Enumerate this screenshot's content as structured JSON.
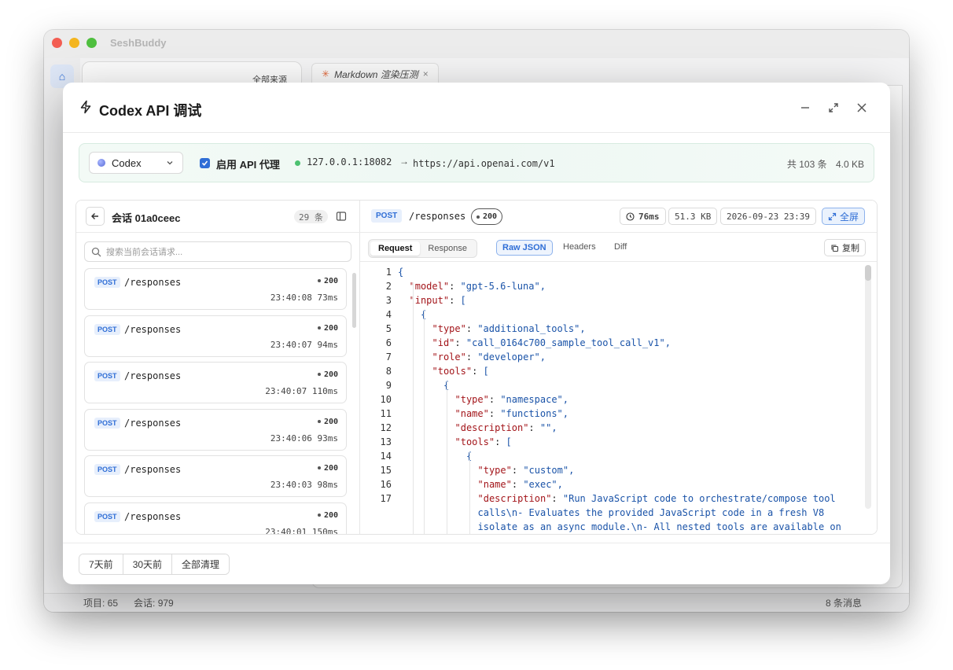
{
  "app": {
    "title": "SeshBuddy"
  },
  "background": {
    "sources_label": "全部来源",
    "doc_tab": "Markdown 渲染压测",
    "status": {
      "items": "项目: 65",
      "sessions": "会话: 979",
      "messages": "8 条消息"
    }
  },
  "modal": {
    "title": "Codex API 调试",
    "provider": "Codex",
    "proxy_label": "启用 API 代理",
    "proxy_enabled": true,
    "listen_addr": "127.0.0.1:18082",
    "arrow": "→",
    "target_url": "https://api.openai.com/v1",
    "total_count": "共 103 条",
    "total_size": "4.0 KB",
    "session": {
      "title": "会话 01a0ceec",
      "count": "29 条",
      "search_placeholder": "搜索当前会话请求..."
    },
    "requests": [
      {
        "method": "POST",
        "path": "/responses",
        "status": "200",
        "time": "23:40:08",
        "duration": "73ms"
      },
      {
        "method": "POST",
        "path": "/responses",
        "status": "200",
        "time": "23:40:07",
        "duration": "94ms"
      },
      {
        "method": "POST",
        "path": "/responses",
        "status": "200",
        "time": "23:40:07",
        "duration": "110ms"
      },
      {
        "method": "POST",
        "path": "/responses",
        "status": "200",
        "time": "23:40:06",
        "duration": "93ms"
      },
      {
        "method": "POST",
        "path": "/responses",
        "status": "200",
        "time": "23:40:03",
        "duration": "98ms"
      },
      {
        "method": "POST",
        "path": "/responses",
        "status": "200",
        "time": "23:40:01",
        "duration": "150ms"
      }
    ],
    "detail": {
      "method": "POST",
      "path": "/responses",
      "status": "200",
      "duration": "76ms",
      "size": "51.3 KB",
      "timestamp": "2026-09-23 23:39",
      "fullscreen_label": "全屏",
      "tabs": {
        "request": "Request",
        "response": "Response"
      },
      "views": {
        "raw": "Raw JSON",
        "headers": "Headers",
        "diff": "Diff"
      },
      "copy_label": "复制"
    },
    "code_lines": [
      {
        "n": "1",
        "depth": 0,
        "k": "",
        "sep": "",
        "v": "",
        "tail": "{"
      },
      {
        "n": "2",
        "depth": 1,
        "k": "\"model\"",
        "sep": ": ",
        "v": "\"gpt-5.6-luna\"",
        "tail": ","
      },
      {
        "n": "3",
        "depth": 1,
        "k": "\"input\"",
        "sep": ": ",
        "v": "",
        "tail": "["
      },
      {
        "n": "4",
        "depth": 2,
        "k": "",
        "sep": "",
        "v": "",
        "tail": "{"
      },
      {
        "n": "5",
        "depth": 3,
        "k": "\"type\"",
        "sep": ": ",
        "v": "\"additional_tools\"",
        "tail": ","
      },
      {
        "n": "6",
        "depth": 3,
        "k": "\"id\"",
        "sep": ": ",
        "v": "\"call_0164c700_sample_tool_call_v1\"",
        "tail": ","
      },
      {
        "n": "7",
        "depth": 3,
        "k": "\"role\"",
        "sep": ": ",
        "v": "\"developer\"",
        "tail": ","
      },
      {
        "n": "8",
        "depth": 3,
        "k": "\"tools\"",
        "sep": ": ",
        "v": "",
        "tail": "["
      },
      {
        "n": "9",
        "depth": 4,
        "k": "",
        "sep": "",
        "v": "",
        "tail": "{"
      },
      {
        "n": "10",
        "depth": 5,
        "k": "\"type\"",
        "sep": ": ",
        "v": "\"namespace\"",
        "tail": ","
      },
      {
        "n": "11",
        "depth": 5,
        "k": "\"name\"",
        "sep": ": ",
        "v": "\"functions\"",
        "tail": ","
      },
      {
        "n": "12",
        "depth": 5,
        "k": "\"description\"",
        "sep": ": ",
        "v": "\"\"",
        "tail": ","
      },
      {
        "n": "13",
        "depth": 5,
        "k": "\"tools\"",
        "sep": ": ",
        "v": "",
        "tail": "["
      },
      {
        "n": "14",
        "depth": 6,
        "k": "",
        "sep": "",
        "v": "",
        "tail": "{"
      },
      {
        "n": "15",
        "depth": 7,
        "k": "\"type\"",
        "sep": ": ",
        "v": "\"custom\"",
        "tail": ","
      },
      {
        "n": "16",
        "depth": 7,
        "k": "\"name\"",
        "sep": ": ",
        "v": "\"exec\"",
        "tail": ","
      },
      {
        "n": "17",
        "depth": 7,
        "k": "\"description\"",
        "sep": ": ",
        "v": "\"Run JavaScript code to orchestrate/compose tool",
        "tail": ""
      },
      {
        "n": "",
        "depth": 7,
        "k": "",
        "sep": "",
        "v": "calls\\n- Evaluates the provided JavaScript code in a fresh V8",
        "tail": ""
      },
      {
        "n": "",
        "depth": 7,
        "k": "",
        "sep": "",
        "v": "isolate as an async module.\\n- All nested tools are available on",
        "tail": ""
      }
    ],
    "footer": {
      "btn7": "7天前",
      "btn30": "30天前",
      "clear": "全部清理"
    }
  },
  "colors": {
    "accent": "#2f6ed6",
    "key": "#a3151a",
    "string": "#1a53a8",
    "proxy_ok": "#4cc170"
  }
}
